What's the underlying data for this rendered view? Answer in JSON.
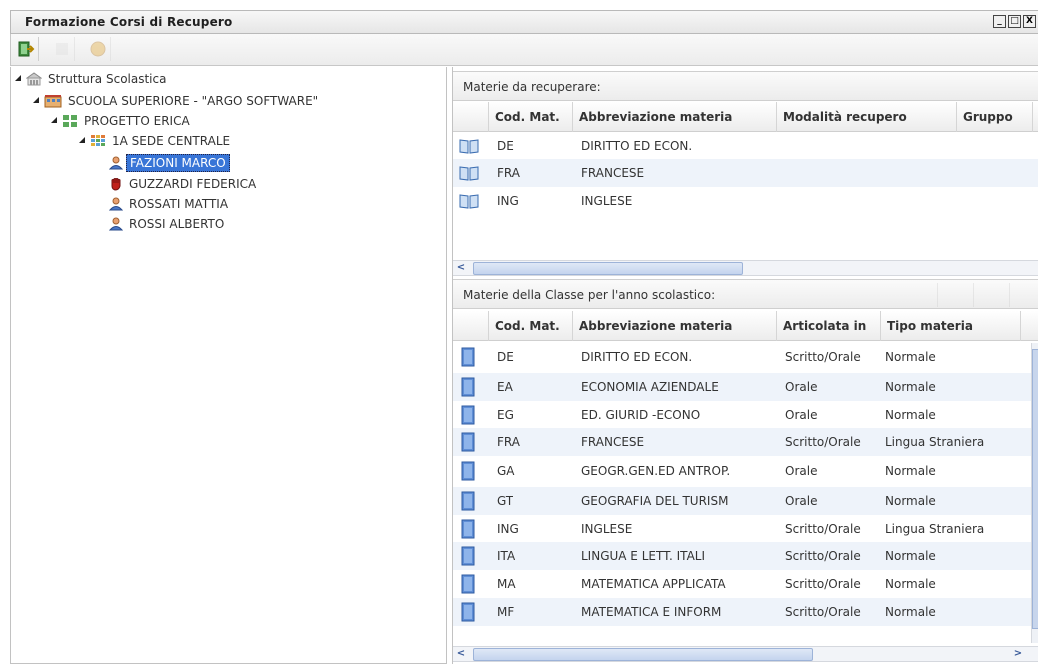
{
  "window": {
    "title": "Formazione Corsi di Recupero",
    "controls": [
      "_",
      "□",
      "X"
    ]
  },
  "toolbar": {
    "buttons": [
      {
        "name": "exit-icon",
        "enabled": true
      },
      {
        "name": "blank-icon",
        "enabled": false
      },
      {
        "name": "coin-icon",
        "enabled": false
      }
    ]
  },
  "tree": {
    "root": "Struttura Scolastica",
    "school": "SCUOLA SUPERIORE - \"ARGO SOFTWARE\"",
    "project": "PROGETTO ERICA",
    "class": "1A SEDE CENTRALE",
    "students": [
      {
        "name": "FAZIONI MARCO",
        "selected": true,
        "icon": "user-icon"
      },
      {
        "name": "GUZZARDI FEDERICA",
        "selected": false,
        "icon": "hand-icon"
      },
      {
        "name": "ROSSATI MATTIA",
        "selected": false,
        "icon": "user-icon"
      },
      {
        "name": "ROSSI ALBERTO",
        "selected": false,
        "icon": "user-icon"
      }
    ]
  },
  "recover": {
    "title": "Materie da recuperare:",
    "columns": [
      "Cod. Mat.",
      "Abbreviazione materia",
      "Modalità recupero",
      "Gruppo"
    ],
    "rows": [
      {
        "code": "DE",
        "name": "DIRITTO ED ECON."
      },
      {
        "code": "FRA",
        "name": "FRANCESE"
      },
      {
        "code": "ING",
        "name": "INGLESE"
      }
    ],
    "scroll_left": "<"
  },
  "classsubjects": {
    "title": "Materie della Classe per l'anno scolastico:",
    "columns": [
      "Cod. Mat.",
      "Abbreviazione materia",
      "Articolata in",
      "Tipo materia"
    ],
    "rows": [
      {
        "code": "DE",
        "name": "DIRITTO ED ECON.",
        "art": "Scritto/Orale",
        "type": "Normale"
      },
      {
        "code": "EA",
        "name": "ECONOMIA AZIENDALE",
        "art": "Orale",
        "type": "Normale"
      },
      {
        "code": "EG",
        "name": "ED. GIURID -ECONO",
        "art": "Orale",
        "type": "Normale"
      },
      {
        "code": "FRA",
        "name": "FRANCESE",
        "art": "Scritto/Orale",
        "type": "Lingua Straniera"
      },
      {
        "code": "GA",
        "name": "GEOGR.GEN.ED ANTROP.",
        "art": "Orale",
        "type": "Normale"
      },
      {
        "code": "GT",
        "name": "GEOGRAFIA DEL TURISM",
        "art": "Orale",
        "type": "Normale"
      },
      {
        "code": "ING",
        "name": "INGLESE",
        "art": "Scritto/Orale",
        "type": "Lingua Straniera"
      },
      {
        "code": "ITA",
        "name": "LINGUA E LETT. ITALI",
        "art": "Scritto/Orale",
        "type": "Normale"
      },
      {
        "code": "MA",
        "name": "MATEMATICA APPLICATA",
        "art": "Scritto/Orale",
        "type": "Normale"
      },
      {
        "code": "MF",
        "name": "MATEMATICA E INFORM",
        "art": "Scritto/Orale",
        "type": "Normale"
      }
    ],
    "scroll_left": "<",
    "scroll_right": ">"
  }
}
